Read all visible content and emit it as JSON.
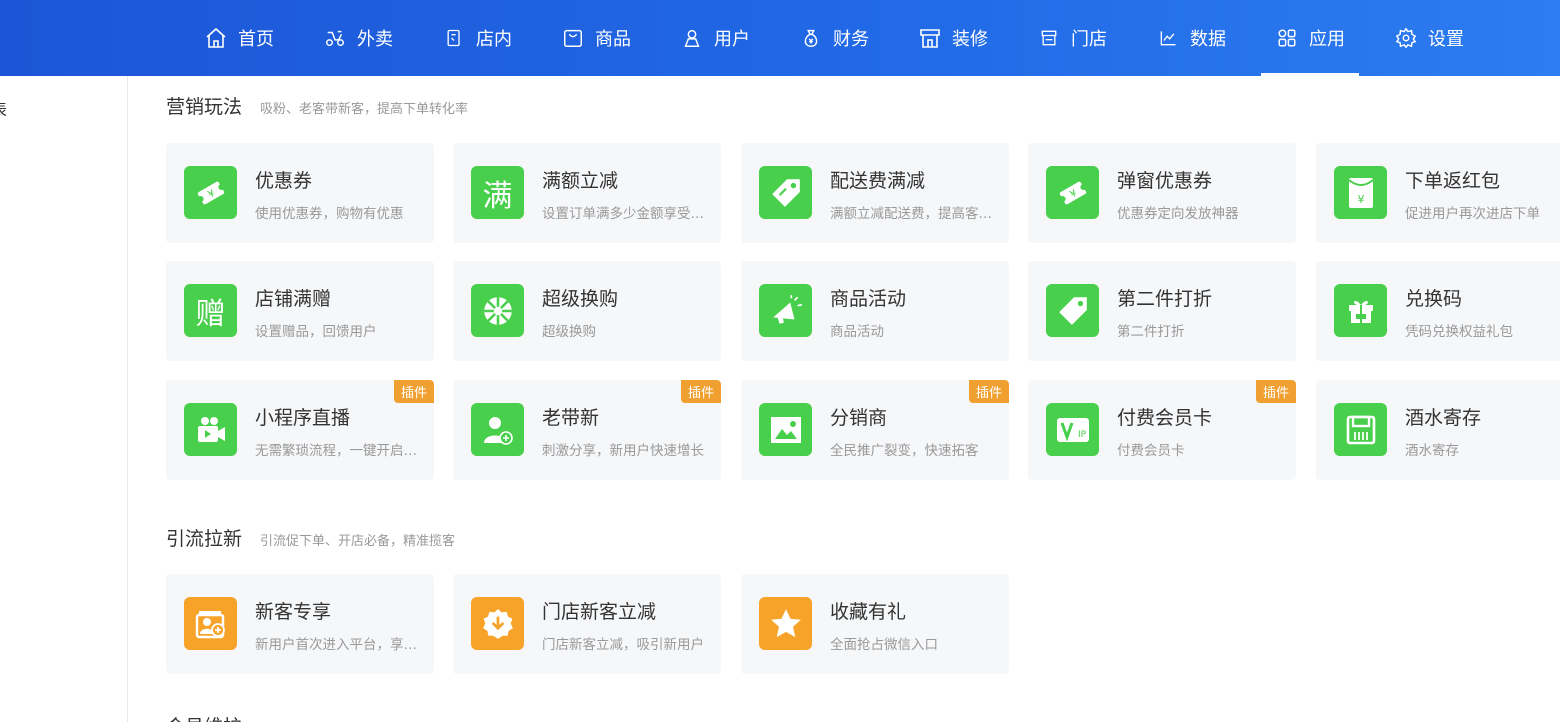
{
  "nav": {
    "items": [
      {
        "label": "首页",
        "icon": "home-icon"
      },
      {
        "label": "外卖",
        "icon": "scooter-icon"
      },
      {
        "label": "店内",
        "icon": "store-tablet-icon"
      },
      {
        "label": "商品",
        "icon": "bag-icon"
      },
      {
        "label": "用户",
        "icon": "user-icon"
      },
      {
        "label": "财务",
        "icon": "money-bag-icon"
      },
      {
        "label": "装修",
        "icon": "shop-front-icon"
      },
      {
        "label": "门店",
        "icon": "storefront-icon"
      },
      {
        "label": "数据",
        "icon": "chart-icon"
      },
      {
        "label": "应用",
        "icon": "apps-icon",
        "active": true
      },
      {
        "label": "设置",
        "icon": "gear-icon"
      }
    ]
  },
  "sidebar": {
    "item_label": "表"
  },
  "sections": [
    {
      "title": "营销玩法",
      "subtitle": "吸粉、老客带新客，提高下单转化率",
      "cards": [
        {
          "title": "优惠券",
          "desc": "使用优惠券，购物有优惠",
          "icon": "coupon-icon",
          "color": "green"
        },
        {
          "title": "满额立减",
          "desc": "设置订单满多少金额享受立减",
          "icon": "full-reduction-icon",
          "color": "green"
        },
        {
          "title": "配送费满减",
          "desc": "满额立减配送费，提高客单价",
          "icon": "price-tag-icon",
          "color": "green"
        },
        {
          "title": "弹窗优惠券",
          "desc": "优惠券定向发放神器",
          "icon": "popup-coupon-icon",
          "color": "green"
        },
        {
          "title": "下单返红包",
          "desc": "促进用户再次进店下单",
          "icon": "red-envelope-icon",
          "color": "green"
        },
        {
          "title": "店铺满赠",
          "desc": "设置赠品，回馈用户",
          "icon": "gift-char-icon",
          "color": "green"
        },
        {
          "title": "超级换购",
          "desc": "超级换购",
          "icon": "wheel-icon",
          "color": "green"
        },
        {
          "title": "商品活动",
          "desc": "商品活动",
          "icon": "megaphone-icon",
          "color": "green"
        },
        {
          "title": "第二件打折",
          "desc": "第二件打折",
          "icon": "discount-tag-icon",
          "color": "green"
        },
        {
          "title": "兑换码",
          "desc": "凭码兑换权益礼包",
          "icon": "gift-box-icon",
          "color": "green"
        },
        {
          "title": "小程序直播",
          "desc": "无需繁琐流程，一键开启直播",
          "icon": "live-camera-icon",
          "color": "green",
          "badge": "插件"
        },
        {
          "title": "老带新",
          "desc": "刺激分享，新用户快速增长",
          "icon": "user-plus-icon",
          "color": "green",
          "badge": "插件"
        },
        {
          "title": "分销商",
          "desc": "全民推广裂变，快速拓客",
          "icon": "image-icon",
          "color": "green",
          "badge": "插件"
        },
        {
          "title": "付费会员卡",
          "desc": "付费会员卡",
          "icon": "vip-card-icon",
          "color": "green",
          "badge": "插件"
        },
        {
          "title": "酒水寄存",
          "desc": "酒水寄存",
          "icon": "storage-icon",
          "color": "green"
        }
      ]
    },
    {
      "title": "引流拉新",
      "subtitle": "引流促下单、开店必备，精准揽客",
      "cards": [
        {
          "title": "新客专享",
          "desc": "新用户首次进入平台，享受优惠",
          "icon": "new-customer-icon",
          "color": "orange"
        },
        {
          "title": "门店新客立减",
          "desc": "门店新客立减，吸引新用户",
          "icon": "badge-down-icon",
          "color": "orange"
        },
        {
          "title": "收藏有礼",
          "desc": "全面抢占微信入口",
          "icon": "star-icon",
          "color": "orange"
        }
      ]
    }
  ],
  "next_section_title": "会员维护"
}
